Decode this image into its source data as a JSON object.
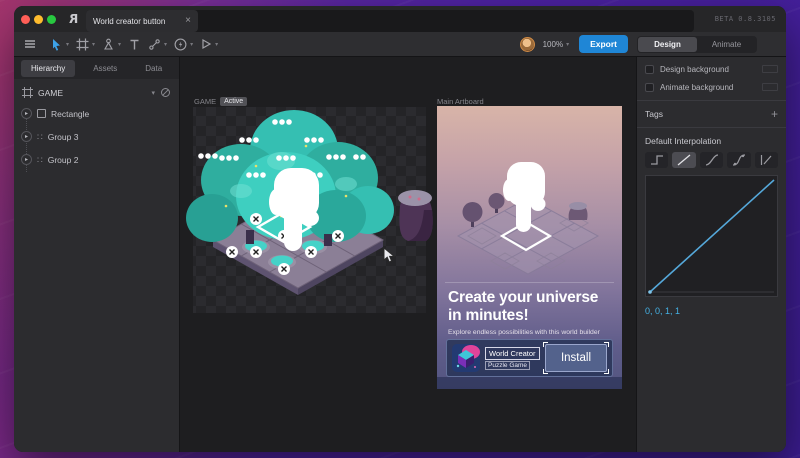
{
  "window": {
    "tab_title": "World creator button",
    "beta_label": "BETA 0.8.3105"
  },
  "icons": {
    "close": "×",
    "caret": "▾",
    "plus": "+",
    "disclosure": "▸",
    "group_glyph": "∷"
  },
  "toolbar": {
    "zoom_level": "100%",
    "export_label": "Export",
    "design_label": "Design",
    "animate_label": "Animate"
  },
  "left_panel": {
    "tabs": [
      {
        "label": "Hierarchy"
      },
      {
        "label": "Assets"
      },
      {
        "label": "Data"
      }
    ],
    "artboard_name": "GAME",
    "items": [
      {
        "label": "Rectangle"
      },
      {
        "label": "Group 3"
      },
      {
        "label": "Group 2"
      }
    ]
  },
  "canvas": {
    "game_label": "GAME",
    "active_badge": "Active",
    "main_artboard_label": "Main Artboard",
    "promo": {
      "headline_line1": "Create your universe",
      "headline_line2": "in minutes!",
      "subtext": "Explore endless possibilities with this world builder",
      "app_name": "World Creator",
      "app_category": "Puzzle Game",
      "install_label": "Install"
    }
  },
  "right_panel": {
    "design_bg_label": "Design background",
    "animate_bg_label": "Animate background",
    "tags_label": "Tags",
    "interpolation_label": "Default Interpolation",
    "cubic_values": "0, 0, 1, 1"
  },
  "colors": {
    "accent_blue": "#1f86d6",
    "curve_cyan": "#55a8da",
    "cubic_text": "#45b2e5",
    "tree_teal": "#3ecfc0",
    "select_tool_blue": "#3da2e8"
  }
}
